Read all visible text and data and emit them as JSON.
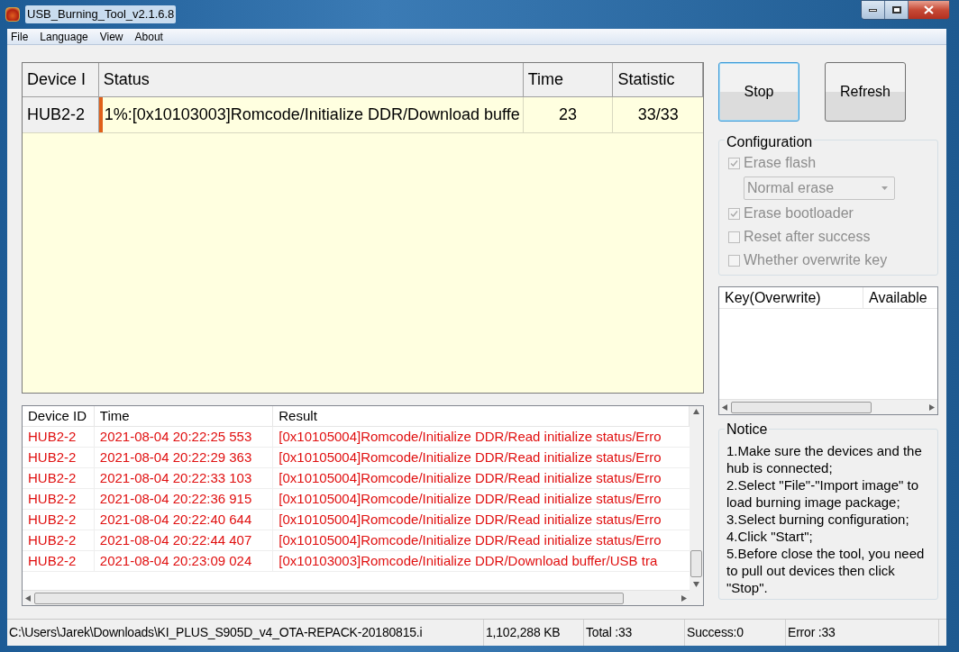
{
  "window": {
    "title": "USB_Burning_Tool_v2.1.6.8"
  },
  "menu": [
    "File",
    "Language",
    "View",
    "About"
  ],
  "device_table": {
    "columns": [
      "Device I",
      "Status",
      "Time",
      "Statistic"
    ],
    "rows": [
      {
        "device_id": "HUB2-2",
        "status": "1%:[0x10103003]Romcode/Initialize DDR/Download buffe",
        "level": 0.01,
        "time": "23",
        "statistic": "33/33"
      }
    ]
  },
  "buttons": [
    {
      "label": "Stop",
      "focused": true
    },
    {
      "label": "Refresh",
      "focused": false
    }
  ],
  "configuration": {
    "title": "Configuration",
    "items": [
      {
        "kind": "checkbox",
        "label": "Erase flash",
        "checked": true,
        "disabled": true
      },
      {
        "kind": "dropdown",
        "value": "Normal erase",
        "disabled": true
      },
      {
        "kind": "checkbox",
        "label": "Erase bootloader",
        "checked": true,
        "disabled": true
      },
      {
        "kind": "checkbox",
        "label": "Reset after success",
        "checked": false,
        "disabled": true
      },
      {
        "kind": "checkbox",
        "label": "Whether overwrite key",
        "checked": false,
        "disabled": true
      }
    ]
  },
  "key_table": {
    "columns": [
      "Key(Overwrite)",
      "Available"
    ]
  },
  "log_table": {
    "columns": [
      "Device ID",
      "Time",
      "Result"
    ],
    "rows": [
      {
        "device_id": "HUB2-2",
        "time": "2021-08-04 20:22:25 553",
        "result": "[0x10105004]Romcode/Initialize DDR/Read initialize status/Erro"
      },
      {
        "device_id": "HUB2-2",
        "time": "2021-08-04 20:22:29 363",
        "result": "[0x10105004]Romcode/Initialize DDR/Read initialize status/Erro"
      },
      {
        "device_id": "HUB2-2",
        "time": "2021-08-04 20:22:33 103",
        "result": "[0x10105004]Romcode/Initialize DDR/Read initialize status/Erro"
      },
      {
        "device_id": "HUB2-2",
        "time": "2021-08-04 20:22:36 915",
        "result": "[0x10105004]Romcode/Initialize DDR/Read initialize status/Erro"
      },
      {
        "device_id": "HUB2-2",
        "time": "2021-08-04 20:22:40 644",
        "result": "[0x10105004]Romcode/Initialize DDR/Read initialize status/Erro"
      },
      {
        "device_id": "HUB2-2",
        "time": "2021-08-04 20:22:44 407",
        "result": "[0x10105004]Romcode/Initialize DDR/Read initialize status/Erro"
      },
      {
        "device_id": "HUB2-2",
        "time": "2021-08-04 20:23:09 024",
        "result": "[0x10103003]Romcode/Initialize DDR/Download buffer/USB tra"
      }
    ]
  },
  "notice": {
    "title": "Notice",
    "lines": [
      "1.Make sure the devices and the hub is connected;",
      "2.Select \"File\"-\"Import image\" to load burning image package;",
      "3.Select burning configuration;",
      "4.Click \"Start\";",
      "5.Before close the tool, you need to pull out devices then click \"Stop\"."
    ]
  },
  "status_bar": [
    "C:\\Users\\Jarek\\Downloads\\KI_PLUS_S905D_v4_OTA-REPACK-20180815.i",
    "1,102,288 KB",
    "Total :33",
    "Success:0",
    "Error :33"
  ]
}
